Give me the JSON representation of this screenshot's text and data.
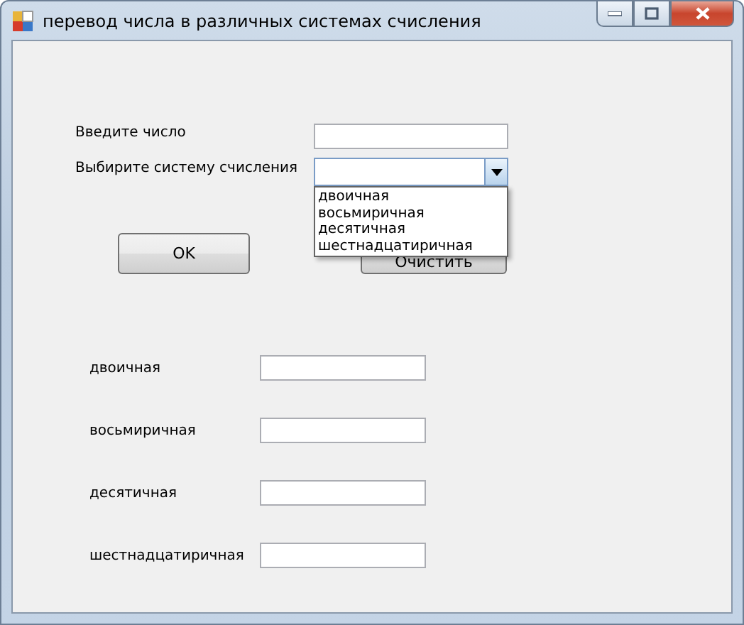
{
  "window": {
    "title": "перевод числа в различных системах счисления"
  },
  "input": {
    "label": "Введите число"
  },
  "base_select": {
    "label": "Выбирите систему счисления",
    "expanded": true,
    "options": [
      "двоичная",
      "восьмиричная",
      "десятичная",
      "шестнадцатиричная"
    ]
  },
  "buttons": [
    {
      "kind": "ok",
      "label": "OK"
    },
    {
      "kind": "clear",
      "label": "Очистить"
    }
  ],
  "results": [
    {
      "label": "двоичная"
    },
    {
      "label": "восьмиричная"
    },
    {
      "label": "десятичная"
    },
    {
      "label": "шестнадцатиричная"
    }
  ]
}
